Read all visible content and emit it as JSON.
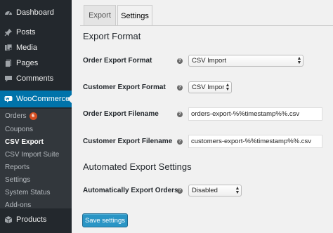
{
  "sidebar": {
    "top_items": [
      {
        "label": "Dashboard",
        "icon": "dashboard-icon"
      },
      {
        "label": "Posts",
        "icon": "pin-icon"
      },
      {
        "label": "Media",
        "icon": "media-icon"
      },
      {
        "label": "Pages",
        "icon": "pages-icon"
      },
      {
        "label": "Comments",
        "icon": "comments-icon"
      }
    ],
    "active_item": {
      "label": "WooCommerce",
      "icon": "woocommerce-icon"
    },
    "submenu": [
      {
        "label": "Orders",
        "badge": "6"
      },
      {
        "label": "Coupons"
      },
      {
        "label": "CSV Export",
        "current": true
      },
      {
        "label": "CSV Import Suite"
      },
      {
        "label": "Reports"
      },
      {
        "label": "Settings"
      },
      {
        "label": "System Status"
      },
      {
        "label": "Add-ons"
      }
    ],
    "bottom_item": {
      "label": "Products",
      "icon": "products-icon"
    }
  },
  "tabs": [
    {
      "label": "Export",
      "active": false
    },
    {
      "label": "Settings",
      "active": true
    }
  ],
  "sections": {
    "export_format": "Export Format",
    "automated": "Automated Export Settings"
  },
  "fields": {
    "order_format": {
      "label": "Order Export Format",
      "value": "CSV Import"
    },
    "customer_format": {
      "label": "Customer Export Format",
      "value": "CSV Import"
    },
    "order_filename": {
      "label": "Order Export Filename",
      "value": "orders-export-%%timestamp%%.csv"
    },
    "customer_filename": {
      "label": "Customer Export Filename",
      "value": "customers-export-%%timestamp%%.csv"
    },
    "auto_export": {
      "label": "Automatically Export Orders",
      "value": "Disabled"
    }
  },
  "help_glyph": "?",
  "save_label": "Save settings",
  "colors": {
    "sidebar_bg": "#23282d",
    "submenu_bg": "#32373c",
    "active_blue": "#0073aa",
    "badge_orange": "#d54e21",
    "button_blue": "#2a95c5"
  }
}
